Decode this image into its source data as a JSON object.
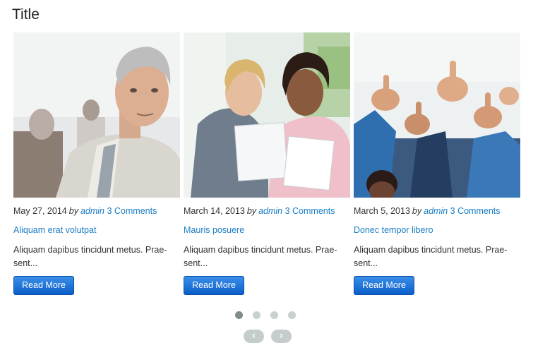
{
  "widget": {
    "title": "Title"
  },
  "posts": [
    {
      "date": "May 27, 2014",
      "by": "by",
      "author": "admin",
      "comments": "3 Comments",
      "title": "Aliquam erat volutpat",
      "excerpt": "Aliquam dapibus tincidunt metus. Prae-sent...",
      "button": "Read More",
      "image": "businessman-photo"
    },
    {
      "date": "March 14, 2013",
      "by": "by",
      "author": "admin",
      "comments": "3 Comments",
      "title": "Mauris posuere",
      "excerpt": "Aliquam dapibus tincidunt metus. Prae-sent...",
      "button": "Read More",
      "image": "two-women-reading-photo"
    },
    {
      "date": "March 5, 2013",
      "by": "by",
      "author": "admin",
      "comments": "3 Comments",
      "title": "Donec tempor libero",
      "excerpt": "Aliquam dapibus tincidunt metus. Prae-sent...",
      "button": "Read More",
      "image": "thumbs-up-crowd-photo"
    }
  ],
  "pagination": {
    "pages": 4,
    "active": 1
  },
  "nav": {
    "prev": "‹",
    "next": "›"
  },
  "colors": {
    "link": "#1a7dc6",
    "button": "#0b5ec9",
    "dot_active": "#7f8c8c",
    "dot": "#c9d0d0"
  }
}
